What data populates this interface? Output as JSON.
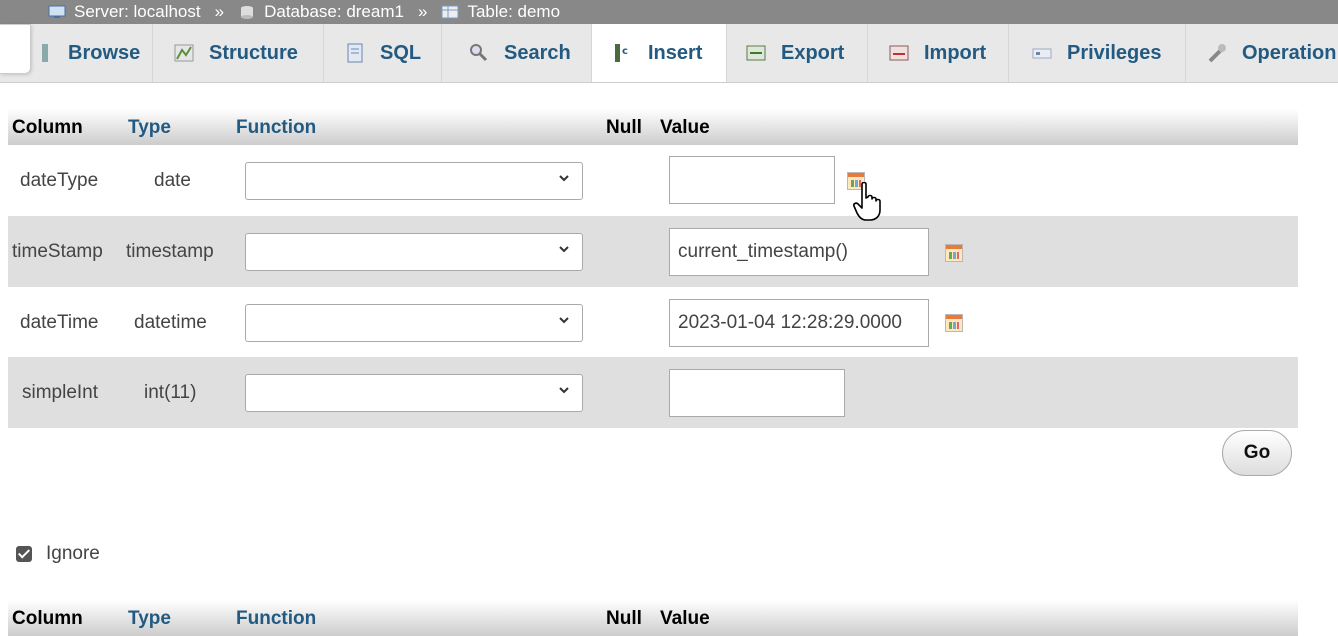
{
  "breadcrumb": {
    "items": [
      {
        "label": "Server: localhost",
        "icon": "server-icon"
      },
      {
        "label": "Database: dream1",
        "icon": "database-icon"
      },
      {
        "label": "Table: demo",
        "icon": "table-icon"
      }
    ],
    "separator": "»"
  },
  "tabs": [
    {
      "label": "Browse",
      "icon": "browse-icon"
    },
    {
      "label": "Structure",
      "icon": "structure-icon"
    },
    {
      "label": "SQL",
      "icon": "sql-icon"
    },
    {
      "label": "Search",
      "icon": "search-icon"
    },
    {
      "label": "Insert",
      "icon": "insert-icon",
      "active": true
    },
    {
      "label": "Export",
      "icon": "export-icon"
    },
    {
      "label": "Import",
      "icon": "import-icon"
    },
    {
      "label": "Privileges",
      "icon": "privileges-icon"
    },
    {
      "label": "Operation",
      "icon": "wrench-icon"
    }
  ],
  "table": {
    "headers": {
      "column": "Column",
      "type": "Type",
      "function": "Function",
      "null": "Null",
      "value": "Value"
    },
    "rows": [
      {
        "column": "dateType",
        "type": "date",
        "function": "",
        "value": ""
      },
      {
        "column": "timeStamp",
        "type": "timestamp",
        "function": "",
        "value": "current_timestamp()"
      },
      {
        "column": "dateTime",
        "type": "datetime",
        "function": "",
        "value": "2023-01-04 12:28:29.0000"
      },
      {
        "column": "simpleInt",
        "type": "int(11)",
        "function": "",
        "value": ""
      }
    ]
  },
  "go_label": "Go",
  "ignore": {
    "label": "Ignore",
    "checked": true
  },
  "colors": {
    "link": "#235a81",
    "breadcrumb_bg": "#888888",
    "row_alt": "#dfdfdf"
  }
}
